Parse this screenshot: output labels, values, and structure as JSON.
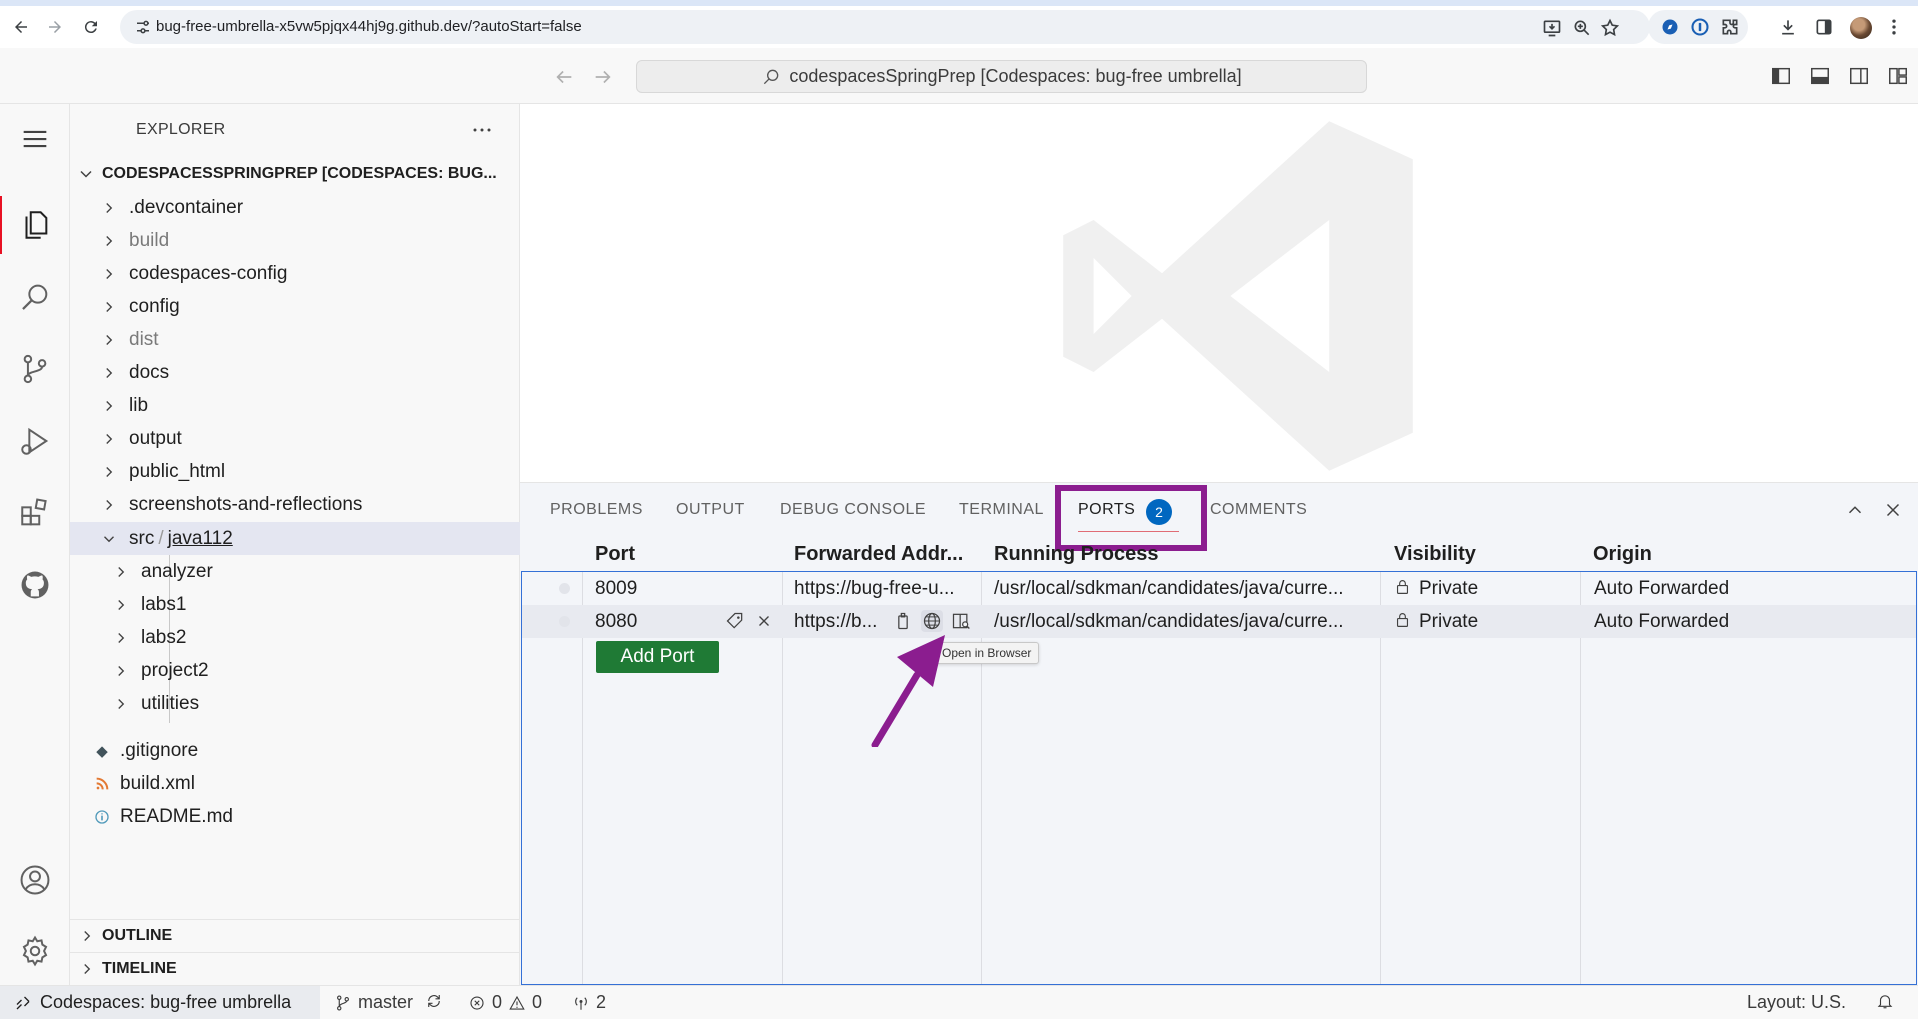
{
  "browser": {
    "url": "bug-free-umbrella-x5vw5pjqx44hj9g.github.dev/?autoStart=false"
  },
  "titlebar": {
    "command_center": "codespacesSpringPrep [Codespaces: bug-free umbrella]"
  },
  "explorer": {
    "title": "EXPLORER",
    "root": "CODESPACESSPRINGPREP [CODESPACES: BUG...",
    "items": [
      {
        "label": ".devcontainer",
        "dim": false
      },
      {
        "label": "build",
        "dim": true
      },
      {
        "label": "codespaces-config",
        "dim": false
      },
      {
        "label": "config",
        "dim": false
      },
      {
        "label": "dist",
        "dim": true
      },
      {
        "label": "docs",
        "dim": false
      },
      {
        "label": "lib",
        "dim": false
      },
      {
        "label": "output",
        "dim": false
      },
      {
        "label": "public_html",
        "dim": false
      },
      {
        "label": "screenshots-and-reflections",
        "dim": false
      }
    ],
    "src_folder": {
      "part1": "src",
      "sep": "/",
      "part2": "java112"
    },
    "src_children": [
      "analyzer",
      "labs1",
      "labs2",
      "project2",
      "utilities"
    ],
    "files": [
      ".gitignore",
      "build.xml",
      "README.md"
    ],
    "outline": "OUTLINE",
    "timeline": "TIMELINE"
  },
  "panel": {
    "tabs": [
      "PROBLEMS",
      "OUTPUT",
      "DEBUG CONSOLE",
      "TERMINAL",
      "PORTS",
      "COMMENTS"
    ],
    "ports_badge": "2",
    "columns": [
      "Port",
      "Forwarded Addr...",
      "Running Process",
      "Visibility",
      "Origin"
    ],
    "rows": [
      {
        "port": "8009",
        "address": "https://bug-free-u...",
        "process": "/usr/local/sdkman/candidates/java/curre...",
        "visibility": "Private",
        "origin": "Auto Forwarded"
      },
      {
        "port": "8080",
        "address": "https://b...",
        "process": "/usr/local/sdkman/candidates/java/curre...",
        "visibility": "Private",
        "origin": "Auto Forwarded"
      }
    ],
    "add_port": "Add Port",
    "tooltip": "Open in Browser"
  },
  "statusbar": {
    "remote": "Codespaces: bug-free umbrella",
    "branch": "master",
    "errors": "0",
    "warnings": "0",
    "ports": "2",
    "layout": "Layout: U.S."
  },
  "colors": {
    "accent_blue": "#0067c0",
    "add_port_green": "#1f7a35",
    "highlight_purple": "#8b1d8f",
    "active_indicator": "#e81123"
  }
}
